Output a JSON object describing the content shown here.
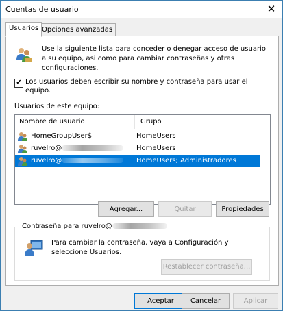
{
  "window": {
    "title": "Cuentas de usuario",
    "close_icon": "close-icon"
  },
  "tabs": [
    {
      "label": "Usuarios",
      "active": true
    },
    {
      "label": "Opciones avanzadas",
      "active": false
    }
  ],
  "intro": {
    "text": "Use la siguiente lista para conceder o denegar acceso de usuario a su equipo, así como para cambiar contraseñas y otras configuraciones.",
    "icon": "users-icon"
  },
  "require_login": {
    "checked": true,
    "label": "Los usuarios deben escribir su nombre y contraseña para usar el equipo."
  },
  "users_list": {
    "label": "Usuarios de este equipo:",
    "columns": [
      "Nombre de usuario",
      "Grupo"
    ],
    "rows": [
      {
        "name": "HomeGroupUser$",
        "group": "HomeUsers",
        "redacted": false,
        "selected": false
      },
      {
        "name": "ruvelro@",
        "group": "HomeUsers",
        "redacted": true,
        "selected": false
      },
      {
        "name": "ruvelro@",
        "group": "HomeUsers; Administradores",
        "redacted": true,
        "selected": true
      }
    ]
  },
  "list_buttons": {
    "add": "Agregar...",
    "remove": "Quitar",
    "properties": "Propiedades"
  },
  "password_group": {
    "title": "Contraseña para ruvelro@",
    "text": "Para cambiar la contraseña, vaya a Configuración y seleccione Usuarios.",
    "reset_button": "Restablecer contraseña..."
  },
  "dialog_buttons": {
    "ok": "Aceptar",
    "cancel": "Cancelar",
    "apply": "Aplicar"
  },
  "colors": {
    "selection": "#0078d7",
    "accent_border": "#0078d7",
    "window_border": "#3c7fb1"
  }
}
